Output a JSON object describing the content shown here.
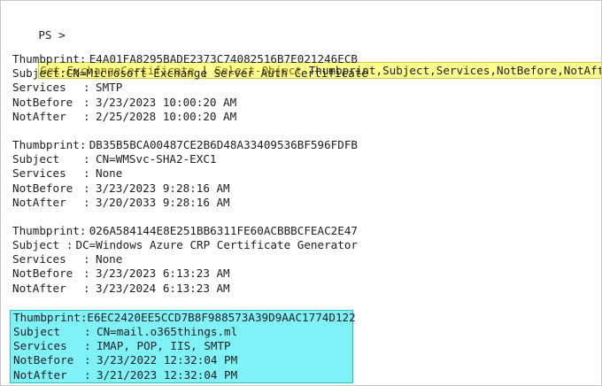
{
  "command": {
    "prompt": "PS >",
    "cmdlet": "Get-ExchangeCertificate",
    "pipe": "|",
    "select": "Select-Object",
    "properties": "Thumbprint,Subject,Services,NotBefore,NotAfter"
  },
  "separator": ":",
  "fields": [
    "Thumbprint",
    "Subject",
    "Services",
    "NotBefore",
    "NotAfter"
  ],
  "certificates": [
    {
      "Thumbprint": "E4A01FA8295BADE2373C74082516B7E021246ECB",
      "Subject": "CN=Microsoft Exchange Server Auth Certificate",
      "Services": "SMTP",
      "NotBefore": "3/23/2023 10:00:20 AM",
      "NotAfter": "2/25/2028 10:00:20 AM",
      "highlighted": false
    },
    {
      "Thumbprint": "DB35B5BCA00487CE2B6D48A33409536BF596FDFB",
      "Subject": "CN=WMSvc-SHA2-EXC1",
      "Services": "None",
      "NotBefore": "3/23/2023 9:28:16 AM",
      "NotAfter": "3/20/2033 9:28:16 AM",
      "highlighted": false
    },
    {
      "Thumbprint": "026A584144E8E251BB6311FE60ACBBBCFEAC2E47",
      "Subject": "DC=Windows Azure CRP Certificate Generator",
      "Services": "None",
      "NotBefore": "3/23/2023 6:13:23 AM",
      "NotAfter": "3/23/2024 6:13:23 AM",
      "highlighted": false
    },
    {
      "Thumbprint": "E6EC2420EE5CCD7B8F988573A39D9AAC1774D122",
      "Subject": "CN=mail.o365things.ml",
      "Services": "IMAP, POP, IIS, SMTP",
      "NotBefore": "3/23/2022 12:32:04 PM",
      "NotAfter": "3/21/2023 12:32:04 PM",
      "highlighted": true
    }
  ],
  "colors": {
    "command_highlight": "#fefd8e",
    "row_highlight": "#7ef2f7",
    "row_highlight_border": "#2dbfc8"
  }
}
